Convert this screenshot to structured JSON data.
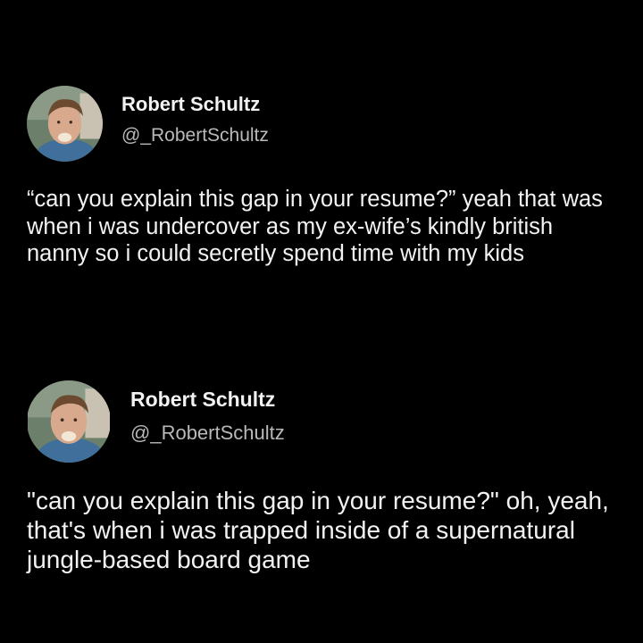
{
  "tweets": [
    {
      "author": {
        "name": "Robert Schultz",
        "handle": "@_RobertSchultz",
        "avatar_icon": "profile-photo-avatar"
      },
      "text": "“can you explain this gap in your resume?” yeah that was when i was undercover as my ex-wife’s kindly british nanny so i could secretly spend time with my kids"
    },
    {
      "author": {
        "name": "Robert Schultz",
        "handle": "@_RobertSchultz",
        "avatar_icon": "profile-photo-avatar"
      },
      "text": "\"can you explain this gap in your resume?\" oh, yeah, that's when i was trapped inside of a supernatural jungle-based board game"
    }
  ],
  "colors": {
    "background": "#000000",
    "name": "#f2f2f2",
    "handle": "#b9b9b9",
    "text": "#f2f2f2"
  }
}
